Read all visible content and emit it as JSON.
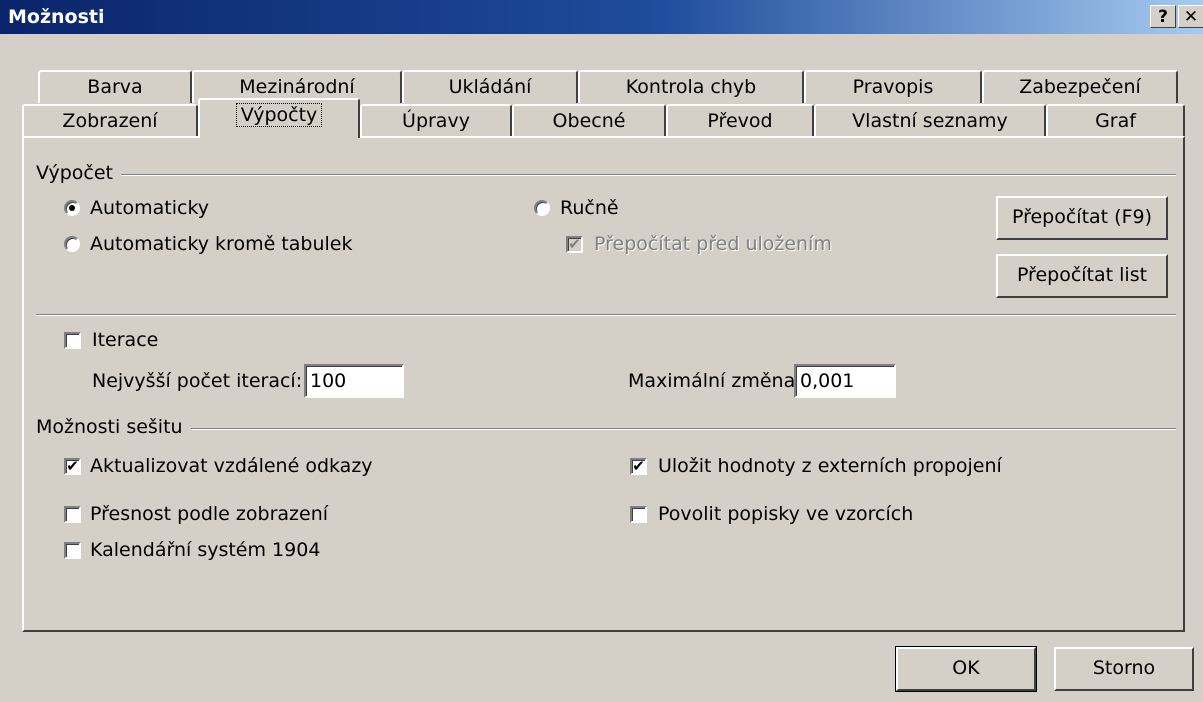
{
  "window": {
    "title": "Možnosti",
    "help_label": "?",
    "close_label": "✕"
  },
  "tabs": {
    "row1": [
      "Barva",
      "Mezinárodní",
      "Ukládání",
      "Kontrola chyb",
      "Pravopis",
      "Zabezpečení"
    ],
    "row2": [
      "Zobrazení",
      "Výpočty",
      "Úpravy",
      "Obecné",
      "Převod",
      "Vlastní seznamy",
      "Graf"
    ],
    "active": "Výpočty"
  },
  "calculation": {
    "group_label": "Výpočet",
    "automatic": "Automaticky",
    "automatic_except_tables": "Automaticky kromě tabulek",
    "manual": "Ručně",
    "recalc_before_save": "Přepočítat před uložením",
    "recalc_now_button": "Přepočítat (F9)",
    "recalc_sheet_button": "Přepočítat list",
    "selected": "Automaticky",
    "recalc_before_save_checked": true
  },
  "iteration": {
    "label": "Iterace",
    "checked": false,
    "max_iterations_label": "Nejvyšší počet iterací:",
    "max_iterations_value": "100",
    "max_change_label": "Maximální změna:",
    "max_change_value": "0,001"
  },
  "workbook": {
    "group_label": "Možnosti sešitu",
    "update_remote_refs": "Aktualizovat vzdálené odkazy",
    "update_remote_refs_checked": true,
    "precision_as_displayed": "Přesnost podle zobrazení",
    "precision_as_displayed_checked": false,
    "date_1904": "Kalendářní systém 1904",
    "date_1904_checked": false,
    "save_external_values": "Uložit hodnoty z externích propojení",
    "save_external_values_checked": true,
    "accept_labels": "Povolit popisky ve vzorcích",
    "accept_labels_checked": false
  },
  "footer": {
    "ok_label": "OK",
    "cancel_label": "Storno"
  }
}
